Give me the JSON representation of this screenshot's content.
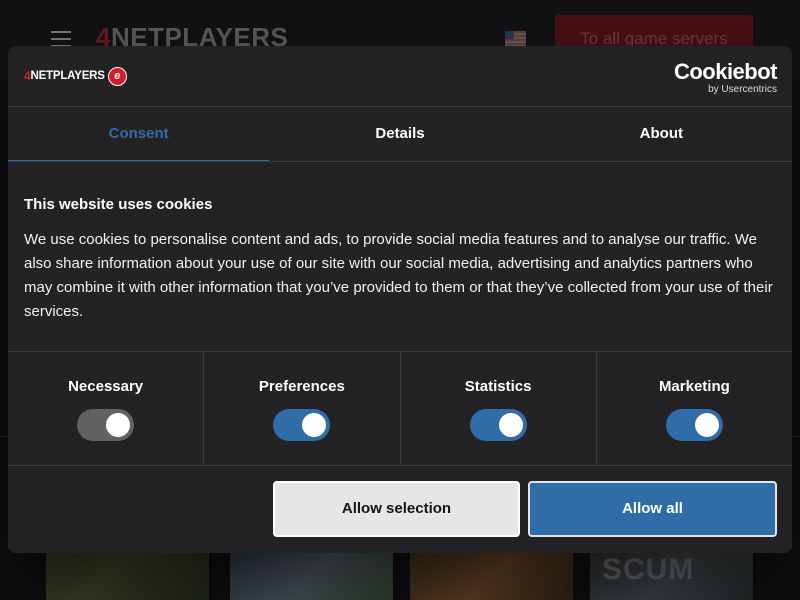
{
  "site": {
    "logo_prefix": "4",
    "logo_text": "NETPLAYERS",
    "servers_button": "To all game servers",
    "thumbnail_text": "SCUM"
  },
  "dialog": {
    "logo_prefix": "4",
    "logo_text": "NETPLAYERS",
    "logo_badge": "e",
    "cookiebot_name": "Cookiebot",
    "cookiebot_by": "by Usercentrics",
    "tabs": [
      {
        "label": "Consent",
        "active": true
      },
      {
        "label": "Details",
        "active": false
      },
      {
        "label": "About",
        "active": false
      }
    ],
    "title": "This website uses cookies",
    "body": "We use cookies to personalise content and ads, to provide social media features and to analyse our traffic. We also share information about your use of our site with our social media, advertising and analytics partners who may combine it with other information that you’ve provided to them or that they’ve collected from your use of their services.",
    "categories": [
      {
        "label": "Necessary",
        "enabled": true,
        "locked": true
      },
      {
        "label": "Preferences",
        "enabled": true,
        "locked": false
      },
      {
        "label": "Statistics",
        "enabled": true,
        "locked": false
      },
      {
        "label": "Marketing",
        "enabled": true,
        "locked": false
      }
    ],
    "buttons": {
      "allow_selection": "Allow selection",
      "allow_all": "Allow all"
    }
  },
  "colors": {
    "accent": "#2f6ca8",
    "dialog_bg": "#232325",
    "brand_red": "#d11f2a"
  }
}
